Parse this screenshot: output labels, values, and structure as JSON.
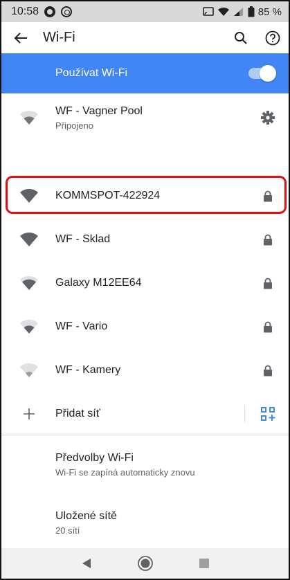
{
  "status_bar": {
    "time": "10:58",
    "battery": "85 %"
  },
  "app_bar": {
    "title": "Wi-Fi"
  },
  "wifi_toggle": {
    "label": "Používat Wi-Fi",
    "enabled": true,
    "accent": "#4285f4"
  },
  "networks": [
    {
      "name": "WF - Vagner Pool",
      "status": "Připojeno",
      "signal": 2,
      "trail_icon": "gear-icon"
    },
    {
      "name": "KOMMSPOT-422924",
      "status": "",
      "signal": 4,
      "trail_icon": "lock-icon",
      "highlighted": true
    },
    {
      "name": "WF - Sklad",
      "status": "",
      "signal": 4,
      "trail_icon": "lock-icon"
    },
    {
      "name": "Galaxy M12EE64",
      "status": "",
      "signal": 3,
      "trail_icon": "lock-icon"
    },
    {
      "name": "WF - Vario",
      "status": "",
      "signal": 2,
      "trail_icon": "lock-icon"
    },
    {
      "name": "WF - Kamery",
      "status": "",
      "signal": 1,
      "trail_icon": "lock-icon"
    }
  ],
  "add_network": {
    "label": "Přidat síť"
  },
  "preferences": {
    "title": "Předvolby Wi-Fi",
    "subtitle": "Wi-Fi se zapíná automaticky znovu"
  },
  "saved_networks": {
    "title": "Uložené sítě",
    "subtitle": "20 sítí"
  }
}
